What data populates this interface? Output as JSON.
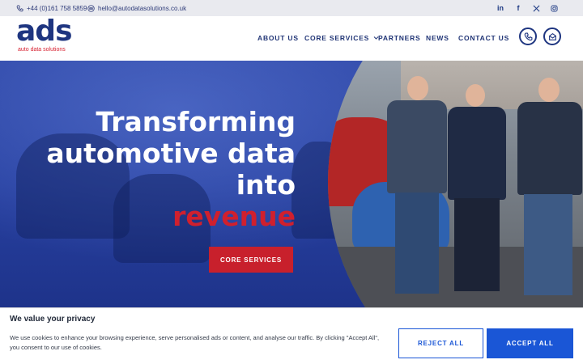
{
  "topbar": {
    "phone": "+44 (0)161 758 5859",
    "email": "hello@autodatasolutions.co.uk",
    "social": [
      "linkedin",
      "facebook",
      "x",
      "instagram"
    ]
  },
  "logo": {
    "mark": "ads",
    "tagline": "auto data solutions"
  },
  "nav": {
    "items": [
      "ABOUT US",
      "CORE SERVICES",
      "PARTNERS",
      "NEWS",
      "CONTACT US"
    ]
  },
  "header_icons": [
    "phone-icon",
    "mail-icon"
  ],
  "hero": {
    "title_line1": "Transforming",
    "title_line2": "automotive data",
    "title_line3": "into",
    "title_accent": "revenue",
    "cta": "CORE SERVICES"
  },
  "cookie": {
    "title": "We value your privacy",
    "text": "We use cookies to enhance your browsing experience, serve personalised ads or content, and analyse our traffic. By clicking \"Accept All\", you consent to our use of cookies.",
    "reject": "REJECT ALL",
    "accept": "ACCEPT ALL"
  },
  "colors": {
    "brand_blue": "#1e3580",
    "brand_red": "#d0202e",
    "hero_blue": "#283f9b",
    "button_blue": "#1a56d6"
  }
}
